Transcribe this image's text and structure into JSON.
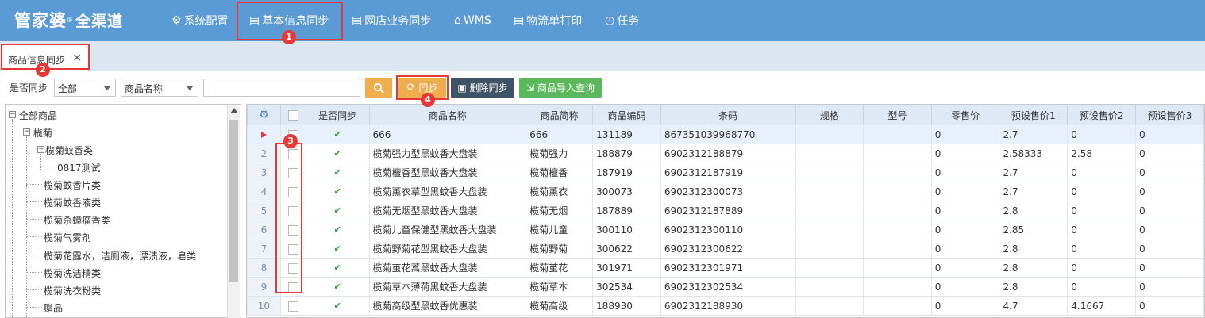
{
  "app": {
    "logo": "管家婆",
    "logo_sub": "全渠道",
    "reg": "®"
  },
  "nav": [
    {
      "label": "系统配置",
      "icon": "gear-icon",
      "glyph": "⚙"
    },
    {
      "label": "基本信息同步",
      "icon": "document-icon",
      "glyph": "▤"
    },
    {
      "label": "网店业务同步",
      "icon": "list-icon",
      "glyph": "▤"
    },
    {
      "label": "WMS",
      "icon": "home-icon",
      "glyph": "⌂"
    },
    {
      "label": "物流单打印",
      "icon": "printer-icon",
      "glyph": "▤"
    },
    {
      "label": "任务",
      "icon": "clock-icon",
      "glyph": "◷"
    }
  ],
  "tab": {
    "label": "商品信息同步",
    "close": "×"
  },
  "toolbar": {
    "sync_label": "是否同步",
    "sync_select": "全部",
    "field_select": "商品名称",
    "search_value": "",
    "sync_button": "同步",
    "delete_button": "删除同步",
    "import_button": "商品导入查询"
  },
  "annotations": [
    "1",
    "2",
    "3",
    "4"
  ],
  "tree": {
    "root": "全部商品",
    "level1": "榄菊",
    "level2_open": "榄菊蚊香类",
    "leaf": "0817测试",
    "items": [
      "榄菊蚊香片类",
      "榄菊蚊香液类",
      "榄菊杀蟑瘤香类",
      "榄菊气雾剂",
      "榄菊花露水，洁厕液，漂渍液，皂类",
      "榄菊洗洁精类",
      "榄菊洗衣粉类",
      "赠品"
    ]
  },
  "grid": {
    "columns": [
      "是否同步",
      "商品名称",
      "商品简称",
      "商品编码",
      "条码",
      "规格",
      "型号",
      "零售价",
      "预设售价1",
      "预设售价2",
      "预设售价3"
    ],
    "rows": [
      {
        "no": "",
        "synced": "✔",
        "name": "666",
        "short": "666",
        "code": "131189",
        "barcode": "867351039968770",
        "spec": "",
        "model": "",
        "retail": "0",
        "p1": "2.7",
        "p2": "0",
        "p3": "0"
      },
      {
        "no": "2",
        "synced": "✔",
        "name": "榄菊强力型黑蚊香大盘装",
        "short": "榄菊强力",
        "code": "188879",
        "barcode": "6902312188879",
        "spec": "",
        "model": "",
        "retail": "0",
        "p1": "2.58333",
        "p2": "2.58",
        "p3": "0"
      },
      {
        "no": "3",
        "synced": "✔",
        "name": "榄菊檀香型黑蚊香大盘装",
        "short": "榄菊檀香",
        "code": "187919",
        "barcode": "6902312187919",
        "spec": "",
        "model": "",
        "retail": "0",
        "p1": "2.7",
        "p2": "0",
        "p3": "0"
      },
      {
        "no": "4",
        "synced": "✔",
        "name": "榄菊薰衣草型黑蚊香大盘装",
        "short": "榄菊薰衣",
        "code": "300073",
        "barcode": "6902312300073",
        "spec": "",
        "model": "",
        "retail": "0",
        "p1": "2.7",
        "p2": "0",
        "p3": "0"
      },
      {
        "no": "5",
        "synced": "✔",
        "name": "榄菊无烟型黑蚊香大盘装",
        "short": "榄菊无烟",
        "code": "187889",
        "barcode": "6902312187889",
        "spec": "",
        "model": "",
        "retail": "0",
        "p1": "2.8",
        "p2": "0",
        "p3": "0"
      },
      {
        "no": "6",
        "synced": "✔",
        "name": "榄菊儿童保健型黑蚊香大盘装",
        "short": "榄菊儿童",
        "code": "300110",
        "barcode": "6902312300110",
        "spec": "",
        "model": "",
        "retail": "0",
        "p1": "2.85",
        "p2": "0",
        "p3": "0"
      },
      {
        "no": "7",
        "synced": "✔",
        "name": "榄菊野菊花型黑蚊香大盘装",
        "short": "榄菊野菊",
        "code": "300622",
        "barcode": "6902312300622",
        "spec": "",
        "model": "",
        "retail": "0",
        "p1": "2.8",
        "p2": "0",
        "p3": "0"
      },
      {
        "no": "8",
        "synced": "✔",
        "name": "榄菊茧花蒿黑蚊香大盘装",
        "short": "榄菊茧花",
        "code": "301971",
        "barcode": "6902312301971",
        "spec": "",
        "model": "",
        "retail": "0",
        "p1": "2.8",
        "p2": "0",
        "p3": "0"
      },
      {
        "no": "9",
        "synced": "✔",
        "name": "榄菊草本薄荷黑蚊香大盘装",
        "short": "榄菊草本",
        "code": "302534",
        "barcode": "6902312302534",
        "spec": "",
        "model": "",
        "retail": "0",
        "p1": "2.8",
        "p2": "0",
        "p3": "0"
      },
      {
        "no": "10",
        "synced": "✔",
        "name": "榄菊高级型黑蚊香优惠装",
        "short": "榄菊高级",
        "code": "188930",
        "barcode": "6902312188930",
        "spec": "",
        "model": "",
        "retail": "0",
        "p1": "4.7",
        "p2": "4.1667",
        "p3": "0"
      }
    ]
  },
  "colors": {
    "topbar": "#5b9bd5",
    "search": "#f0ad4e",
    "sync": "#f0ad4e",
    "delete": "#3f5366",
    "import": "#5cb85c",
    "highlight": "#e53935",
    "check": "#2e9b2e"
  }
}
